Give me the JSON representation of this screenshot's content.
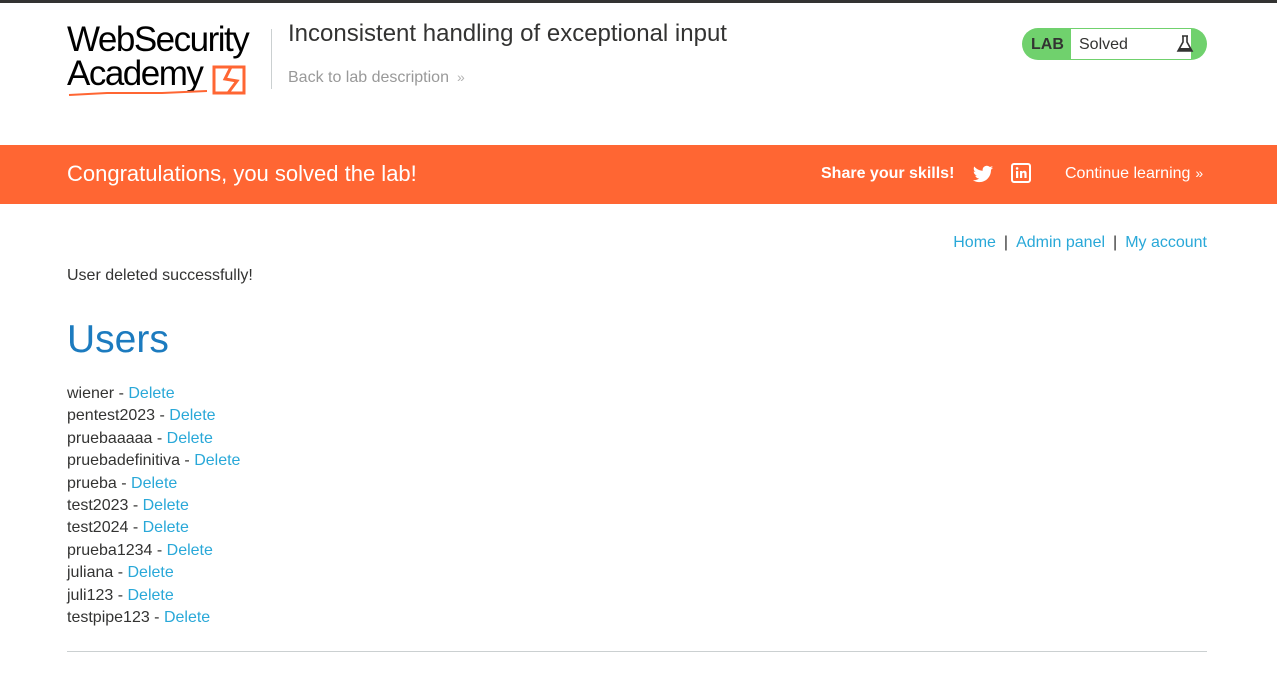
{
  "header": {
    "logo_line1": "WebSecurity",
    "logo_line2": "Academy",
    "lab_title": "Inconsistent handling of exceptional input",
    "back_link": "Back to lab description",
    "lab_badge": "LAB",
    "lab_status": "Solved",
    "colors": {
      "badge": "#70d16d",
      "logo_accent": "#ff6633"
    }
  },
  "banner": {
    "message": "Congratulations, you solved the lab!",
    "share_label": "Share your skills!",
    "twitter_icon": "twitter-icon",
    "linkedin_icon": "linkedin-icon",
    "continue_label": "Continue learning",
    "color": "#ff6633"
  },
  "nav": {
    "home": "Home",
    "admin": "Admin panel",
    "account": "My account",
    "separator": "|"
  },
  "main": {
    "message": "User deleted successfully!",
    "heading": "Users",
    "delete_label": "Delete",
    "users": [
      "wiener",
      "pentest2023",
      "pruebaaaaa",
      "pruebadefinitiva",
      "prueba",
      "test2023",
      "test2024",
      "prueba1234",
      "juliana",
      "juli123",
      "testpipe123"
    ]
  }
}
